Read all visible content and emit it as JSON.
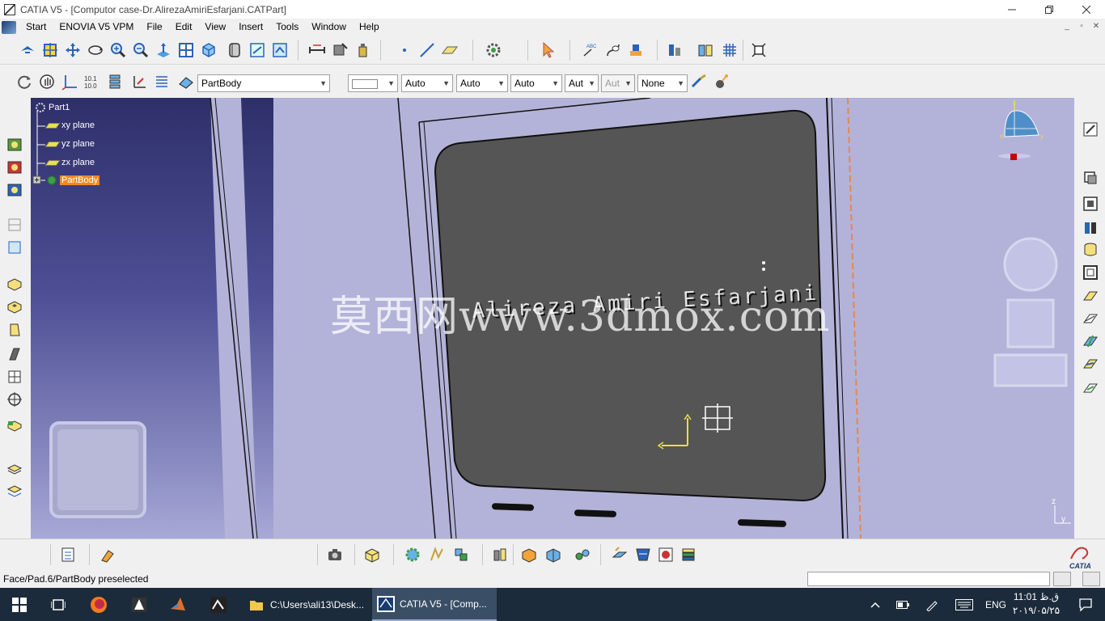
{
  "window": {
    "title": "CATIA V5 - [Computor case-Dr.AlirezaAmiriEsfarjani.CATPart]",
    "controls": [
      "minimize-icon",
      "restore-icon",
      "close-icon"
    ]
  },
  "menubar": {
    "items": [
      "Start",
      "ENOVIA V5 VPM",
      "File",
      "Edit",
      "View",
      "Insert",
      "Tools",
      "Window",
      "Help"
    ]
  },
  "toolbar2": {
    "body_select": "PartBody",
    "line_color": "",
    "line_thickness": "Auto",
    "linetype": "Auto",
    "weight": "Auto",
    "layer_a": "Aut",
    "layer_b": "Aut",
    "layer": "None"
  },
  "tree": {
    "root": "Part1",
    "items": [
      "xy plane",
      "yz plane",
      "zx plane",
      "PartBody"
    ],
    "selected": "PartBody"
  },
  "viewport": {
    "engraved_text": "Alireza Amiri Esfarjani",
    "watermark": "莫西网www.3dmox.com",
    "compass_labels": [
      "z",
      "x",
      "y"
    ],
    "axis_labels": [
      "z",
      "y"
    ]
  },
  "status": {
    "message": "Face/Pad.6/PartBody preselected"
  },
  "taskbar": {
    "tasks": [
      "C:\\Users\\ali13\\Desk...",
      "CATIA V5 - [Comp..."
    ],
    "language": "ENG",
    "time": "11:01 ق.ظ",
    "date": "۲۰۱۹/۰۵/۲۵"
  },
  "colors": {
    "viewport_bg": "#b3b3d9",
    "face_fill": "#555555",
    "selection_orange": "#f08a24",
    "taskbar_bg": "#1c2b3b"
  }
}
